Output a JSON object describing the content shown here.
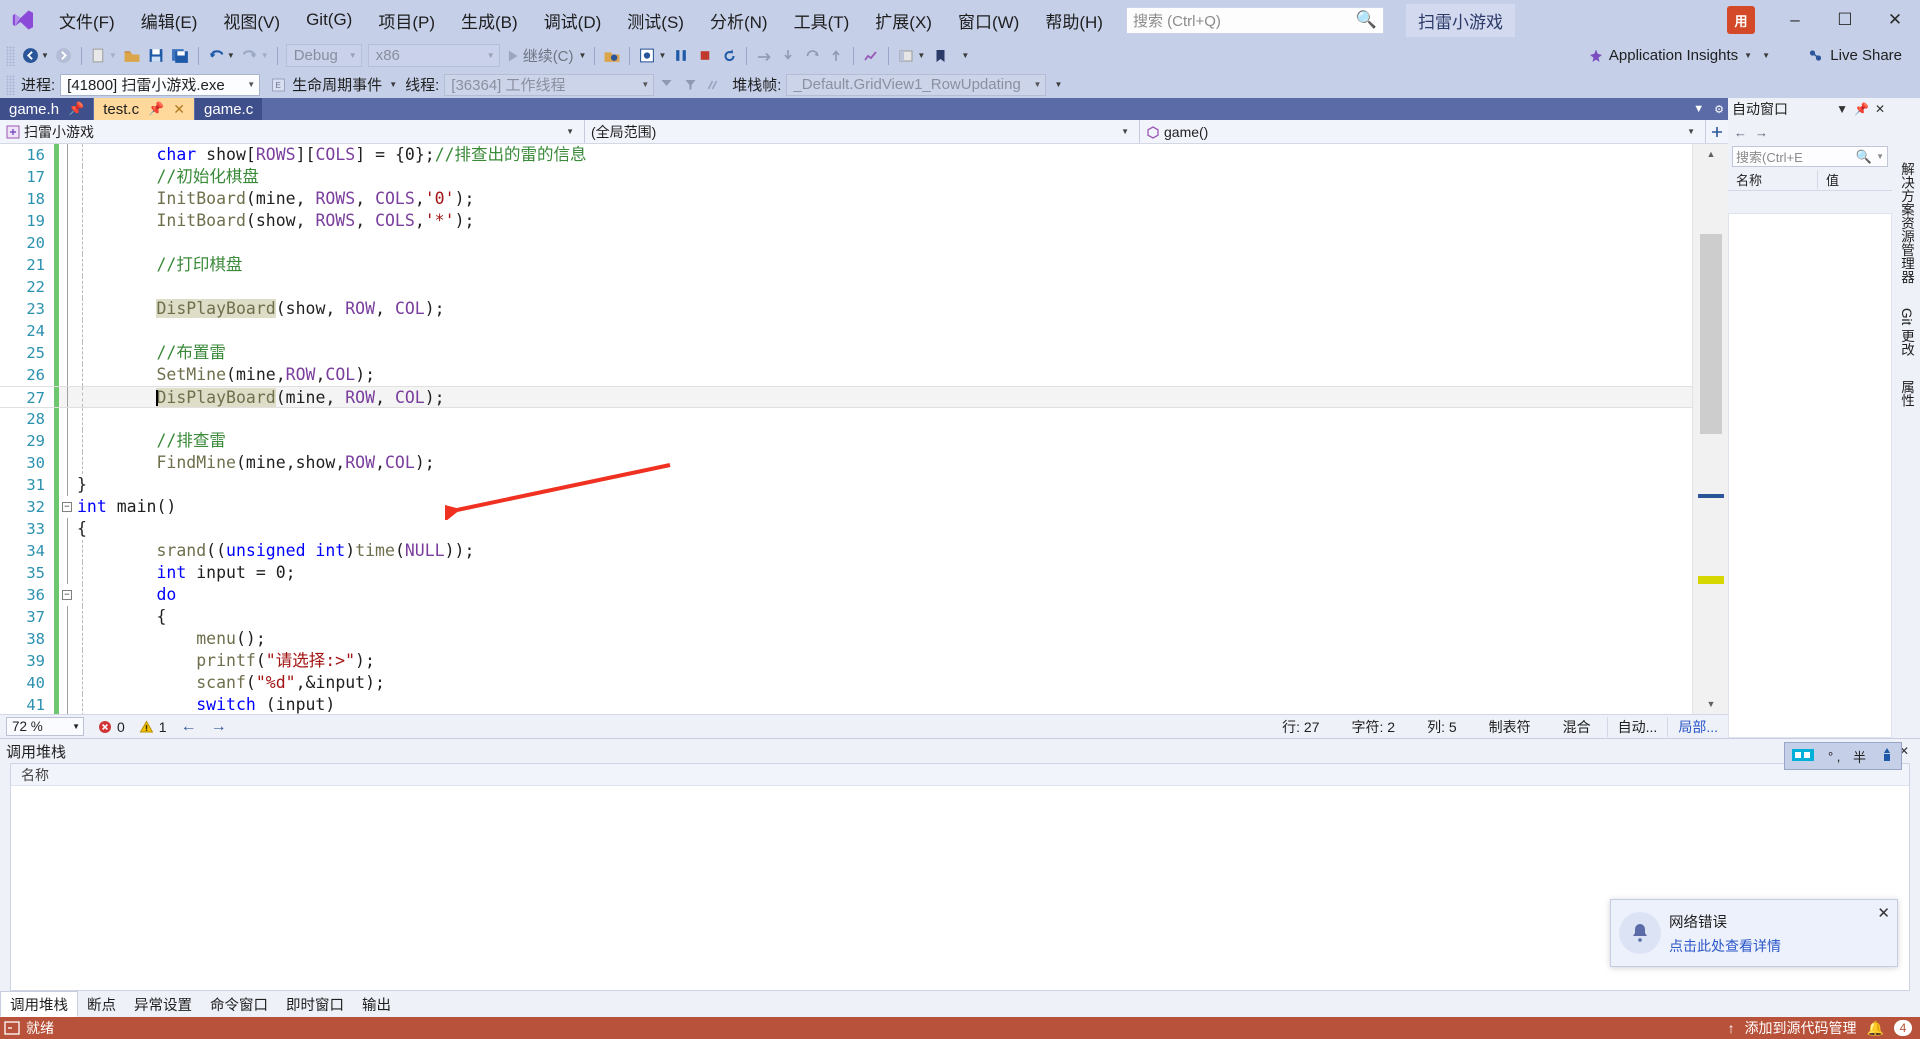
{
  "app": {
    "title": "扫雷小游戏",
    "logo_icon": "visual-studio-logo-icon"
  },
  "menu": {
    "items": [
      {
        "label": "文件(F)",
        "name": "file"
      },
      {
        "label": "编辑(E)",
        "name": "edit"
      },
      {
        "label": "视图(V)",
        "name": "view"
      },
      {
        "label": "Git(G)",
        "name": "git"
      },
      {
        "label": "项目(P)",
        "name": "project"
      },
      {
        "label": "生成(B)",
        "name": "build"
      },
      {
        "label": "调试(D)",
        "name": "debug"
      },
      {
        "label": "测试(S)",
        "name": "test"
      },
      {
        "label": "分析(N)",
        "name": "analyze"
      },
      {
        "label": "工具(T)",
        "name": "tools"
      },
      {
        "label": "扩展(X)",
        "name": "extensions"
      },
      {
        "label": "窗口(W)",
        "name": "window"
      },
      {
        "label": "帮助(H)",
        "name": "help"
      }
    ]
  },
  "search": {
    "placeholder": "搜索 (Ctrl+Q)",
    "icon": "search-icon"
  },
  "window_controls": {
    "minimize": "–",
    "maximize": "☐",
    "close": "✕",
    "user_initials": "用"
  },
  "toolbar": {
    "configuration": "Debug",
    "platform": "x86",
    "continue_label": "继续(C)",
    "app_insights": "Application Insights",
    "live_share": "Live Share",
    "icons": [
      "back-navigate-icon",
      "forward-navigate-icon",
      "new-item-icon",
      "open-file-icon",
      "save-icon",
      "save-all-icon",
      "undo-icon",
      "redo-icon",
      "start-debug-icon",
      "attach-process-icon",
      "break-all-icon",
      "stop-debugging-icon",
      "restart-icon",
      "step-over-icon",
      "step-into-icon",
      "step-out-icon",
      "show-next-statement-icon",
      "bookmark-icon"
    ]
  },
  "debugbar": {
    "process_label": "进程:",
    "process_value": "[41800] 扫雷小游戏.exe",
    "lifecycle_label": "生命周期事件",
    "thread_label": "线程:",
    "thread_value": "[36364] 工作线程",
    "stack_label": "堆栈帧:",
    "stack_value": "_Default.GridView1_RowUpdating"
  },
  "tabs": [
    {
      "label": "game.h",
      "pinned": true,
      "active": false,
      "closable": false
    },
    {
      "label": "test.c",
      "pinned": true,
      "active": true,
      "closable": true
    },
    {
      "label": "game.c",
      "pinned": false,
      "active": false,
      "closable": false
    }
  ],
  "navbar": {
    "project": "扫雷小游戏",
    "scope": "(全局范围)",
    "member": "game()",
    "project_icon": "project-node-icon",
    "member_icon": "method-icon"
  },
  "code": {
    "lines": [
      {
        "n": 16,
        "indent": 2,
        "tokens": [
          {
            "t": "char ",
            "c": "k"
          },
          {
            "t": "show[",
            "c": "op"
          },
          {
            "t": "ROWS",
            "c": "km"
          },
          {
            "t": "][",
            "c": "op"
          },
          {
            "t": "COLS",
            "c": "km"
          },
          {
            "t": "] = {",
            "c": "op"
          },
          {
            "t": "0",
            "c": "num"
          },
          {
            "t": "};",
            "c": "op"
          },
          {
            "t": "//排查出的雷的信息",
            "c": "cm"
          }
        ]
      },
      {
        "n": 17,
        "indent": 2,
        "tokens": [
          {
            "t": "//初始化棋盘",
            "c": "cm"
          }
        ]
      },
      {
        "n": 18,
        "indent": 2,
        "tokens": [
          {
            "t": "InitBoard",
            "c": "fn"
          },
          {
            "t": "(mine, ",
            "c": "op"
          },
          {
            "t": "ROWS",
            "c": "km"
          },
          {
            "t": ", ",
            "c": "op"
          },
          {
            "t": "COLS",
            "c": "km"
          },
          {
            "t": ",",
            "c": "op"
          },
          {
            "t": "'0'",
            "c": "st"
          },
          {
            "t": ");",
            "c": "op"
          }
        ]
      },
      {
        "n": 19,
        "indent": 2,
        "tokens": [
          {
            "t": "InitBoard",
            "c": "fn"
          },
          {
            "t": "(show, ",
            "c": "op"
          },
          {
            "t": "ROWS",
            "c": "km"
          },
          {
            "t": ", ",
            "c": "op"
          },
          {
            "t": "COLS",
            "c": "km"
          },
          {
            "t": ",",
            "c": "op"
          },
          {
            "t": "'*'",
            "c": "st"
          },
          {
            "t": ");",
            "c": "op"
          }
        ]
      },
      {
        "n": 20,
        "indent": 2,
        "tokens": []
      },
      {
        "n": 21,
        "indent": 2,
        "tokens": [
          {
            "t": "//打印棋盘",
            "c": "cm"
          }
        ]
      },
      {
        "n": 22,
        "indent": 2,
        "tokens": []
      },
      {
        "n": 23,
        "indent": 2,
        "tokens": [
          {
            "t": "DisPlayBoard",
            "c": "fn hl"
          },
          {
            "t": "(show, ",
            "c": "op"
          },
          {
            "t": "ROW",
            "c": "km"
          },
          {
            "t": ", ",
            "c": "op"
          },
          {
            "t": "COL",
            "c": "km"
          },
          {
            "t": ");",
            "c": "op"
          }
        ]
      },
      {
        "n": 24,
        "indent": 2,
        "tokens": []
      },
      {
        "n": 25,
        "indent": 2,
        "tokens": [
          {
            "t": "//布置雷",
            "c": "cm"
          }
        ]
      },
      {
        "n": 26,
        "indent": 2,
        "tokens": [
          {
            "t": "SetMine",
            "c": "fn"
          },
          {
            "t": "(mine,",
            "c": "op"
          },
          {
            "t": "ROW",
            "c": "km"
          },
          {
            "t": ",",
            "c": "op"
          },
          {
            "t": "COL",
            "c": "km"
          },
          {
            "t": ");",
            "c": "op"
          }
        ]
      },
      {
        "n": 27,
        "indent": 2,
        "current": true,
        "caret": true,
        "tokens": [
          {
            "t": "DisPlayBoard",
            "c": "fn hl"
          },
          {
            "t": "(mine, ",
            "c": "op"
          },
          {
            "t": "ROW",
            "c": "km"
          },
          {
            "t": ", ",
            "c": "op"
          },
          {
            "t": "COL",
            "c": "km"
          },
          {
            "t": ");",
            "c": "op"
          }
        ]
      },
      {
        "n": 28,
        "indent": 2,
        "tokens": []
      },
      {
        "n": 29,
        "indent": 2,
        "tokens": [
          {
            "t": "//排查雷",
            "c": "cm"
          }
        ]
      },
      {
        "n": 30,
        "indent": 2,
        "tokens": [
          {
            "t": "FindMine",
            "c": "fn"
          },
          {
            "t": "(mine,show,",
            "c": "op"
          },
          {
            "t": "ROW",
            "c": "km"
          },
          {
            "t": ",",
            "c": "op"
          },
          {
            "t": "COL",
            "c": "km"
          },
          {
            "t": ");",
            "c": "op"
          }
        ]
      },
      {
        "n": 31,
        "indent": 0,
        "tokens": [
          {
            "t": "}",
            "c": "op"
          }
        ]
      },
      {
        "n": 32,
        "indent": 0,
        "fold": "minus",
        "tokens": [
          {
            "t": "int",
            "c": "k"
          },
          {
            "t": " main();",
            "c": "op",
            "raw": " main()"
          }
        ]
      },
      {
        "n": 33,
        "indent": 0,
        "tokens": [
          {
            "t": "{",
            "c": "op"
          }
        ]
      },
      {
        "n": 34,
        "indent": 2,
        "tokens": [
          {
            "t": "srand",
            "c": "fn"
          },
          {
            "t": "((",
            "c": "op"
          },
          {
            "t": "unsigned int",
            "c": "k"
          },
          {
            "t": ")",
            "c": "op"
          },
          {
            "t": "time",
            "c": "fn"
          },
          {
            "t": "(",
            "c": "op"
          },
          {
            "t": "NULL",
            "c": "km"
          },
          {
            "t": "));",
            "c": "op"
          }
        ]
      },
      {
        "n": 35,
        "indent": 2,
        "tokens": [
          {
            "t": "int",
            "c": "k"
          },
          {
            "t": " input = ",
            "c": "op"
          },
          {
            "t": "0",
            "c": "num"
          },
          {
            "t": ";",
            "c": "op"
          }
        ]
      },
      {
        "n": 36,
        "indent": 2,
        "fold": "minus",
        "tokens": [
          {
            "t": "do",
            "c": "k"
          }
        ]
      },
      {
        "n": 37,
        "indent": 2,
        "tokens": [
          {
            "t": "{",
            "c": "op"
          }
        ]
      },
      {
        "n": 38,
        "indent": 3,
        "tokens": [
          {
            "t": "menu",
            "c": "fn"
          },
          {
            "t": "();",
            "c": "op"
          }
        ]
      },
      {
        "n": 39,
        "indent": 3,
        "tokens": [
          {
            "t": "printf",
            "c": "fn"
          },
          {
            "t": "(",
            "c": "op"
          },
          {
            "t": "\"请选择:>\"",
            "c": "st"
          },
          {
            "t": ");",
            "c": "op"
          }
        ]
      },
      {
        "n": 40,
        "indent": 3,
        "tokens": [
          {
            "t": "scanf",
            "c": "fn"
          },
          {
            "t": "(",
            "c": "op"
          },
          {
            "t": "\"%d\"",
            "c": "st"
          },
          {
            "t": ",&input);",
            "c": "op"
          }
        ]
      },
      {
        "n": 41,
        "indent": 3,
        "clipped": true,
        "tokens": [
          {
            "t": "switch",
            "c": "k"
          },
          {
            "t": " (input)",
            "c": "op"
          }
        ]
      }
    ]
  },
  "editor_footer": {
    "zoom": "72 %",
    "error_count": "0",
    "warning_count": "1",
    "line_label": "行: 27",
    "char_label": "字符: 2",
    "col_label": "列: 5",
    "tab_mode": "制表符",
    "mixed": "混合",
    "auto_label": "自动...",
    "local_label": "局部...",
    "error_icon": "error-circle-icon",
    "warning_icon": "warning-triangle-icon",
    "prev_icon": "navigate-back-icon",
    "next_icon": "navigate-forward-icon"
  },
  "right_panel": {
    "title": "自动窗口",
    "search_placeholder": "搜索(Ctrl+E",
    "col_name": "名称",
    "col_value": "值",
    "pin_icon": "pin-icon",
    "close_icon": "close-icon",
    "dropdown_icon": "chevron-down-icon",
    "search_icon": "search-icon"
  },
  "vertical_tabs": [
    {
      "label": "解决方案资源管理器",
      "name": "solution-explorer"
    },
    {
      "label": "Git 更改",
      "name": "git-changes"
    },
    {
      "label": "属性",
      "name": "properties"
    }
  ],
  "bottom_panel": {
    "title": "调用堆栈",
    "grid_header": "名称",
    "tabs": [
      {
        "label": "调用堆栈",
        "active": true
      },
      {
        "label": "断点",
        "active": false
      },
      {
        "label": "异常设置",
        "active": false
      },
      {
        "label": "命令窗口",
        "active": false
      },
      {
        "label": "即时窗口",
        "active": false
      },
      {
        "label": "输出",
        "active": false
      }
    ]
  },
  "mini_toolbar": {
    "icons": [
      "restore-window-icon",
      "degree-icon",
      "half-width-icon",
      "keyboard-mode-icon"
    ],
    "labels": [
      "° ,",
      "半"
    ]
  },
  "toast": {
    "title": "网络错误",
    "message": "点击此处查看详情",
    "close": "✕",
    "icon": "notification-bell-icon"
  },
  "status_bar": {
    "ready": "就绪",
    "ready_icon": "ready-icon",
    "source_control": "添加到源代码管理",
    "source_icon": "upload-arrow-icon",
    "notify_count": "4",
    "notify_icon": "bell-icon"
  },
  "colors": {
    "chrome": "#c5cfe8",
    "tab_active": "#ffd89b",
    "tab_inactive": "#3f4f8c",
    "status_debug": "#b8523a",
    "keyword": "#0000ff",
    "macro": "#7a3e9d",
    "comment": "#3a8a3a",
    "string": "#a31515",
    "function": "#6f6f4d",
    "changebar": "#6ec66e",
    "annotation_arrow": "#f03020"
  },
  "annotation": {
    "arrow": "red-arrow-pointing-to-line-27"
  }
}
